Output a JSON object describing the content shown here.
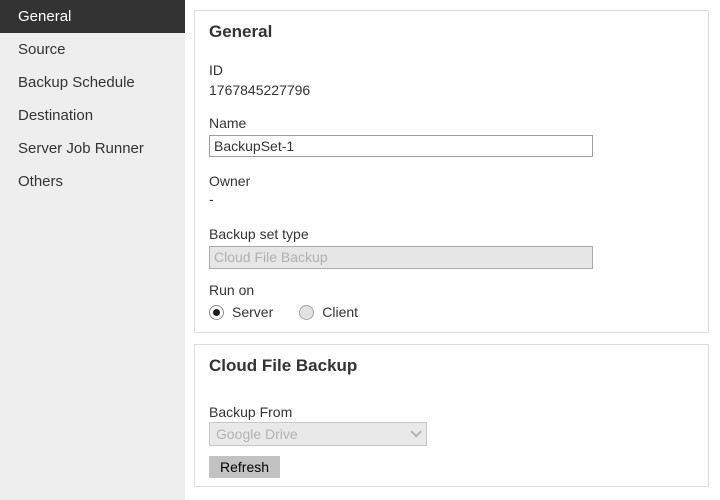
{
  "sidebar": {
    "items": [
      {
        "label": "General",
        "selected": true
      },
      {
        "label": "Source",
        "selected": false
      },
      {
        "label": "Backup Schedule",
        "selected": false
      },
      {
        "label": "Destination",
        "selected": false
      },
      {
        "label": "Server Job Runner",
        "selected": false
      },
      {
        "label": "Others",
        "selected": false
      }
    ]
  },
  "general_section": {
    "title": "General",
    "id_label": "ID",
    "id_value": "1767845227796",
    "name_label": "Name",
    "name_value": "BackupSet-1",
    "owner_label": "Owner",
    "owner_value": "-",
    "backup_set_type_label": "Backup set type",
    "backup_set_type_value": "Cloud File Backup",
    "run_on_label": "Run on",
    "run_on_options": [
      {
        "label": "Server",
        "selected": true
      },
      {
        "label": "Client",
        "selected": false
      }
    ]
  },
  "cloud_section": {
    "title": "Cloud File Backup",
    "backup_from_label": "Backup From",
    "backup_from_value": "Google Drive",
    "refresh_label": "Refresh"
  },
  "colors": {
    "sidebar_bg": "#eeeeee",
    "sidebar_selected_bg": "#333333",
    "sidebar_selected_text": "#ffffff",
    "text": "#333333",
    "card_border": "#dcdcdc",
    "disabled_bg": "#e6e6e6",
    "disabled_text": "#b0b0b0",
    "button_bg": "#c2c2c2"
  }
}
